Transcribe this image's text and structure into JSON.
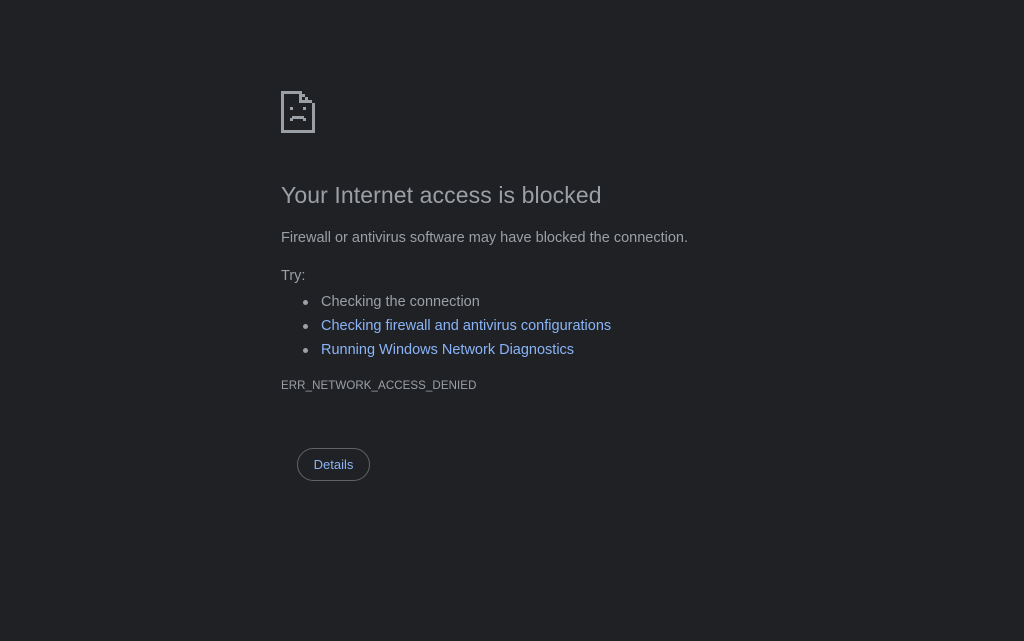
{
  "error": {
    "title": "Your Internet access is blocked",
    "description": "Firewall or antivirus software may have blocked the connection.",
    "try_label": "Try:",
    "suggestions": [
      {
        "text": "Checking the connection",
        "is_link": false
      },
      {
        "text": "Checking firewall and antivirus configurations",
        "is_link": true
      },
      {
        "text": "Running Windows Network Diagnostics",
        "is_link": true
      }
    ],
    "code": "ERR_NETWORK_ACCESS_DENIED",
    "details_label": "Details"
  },
  "icons": {
    "error_icon": "sad-document-icon"
  },
  "colors": {
    "background": "#202124",
    "text": "#9aa0a6",
    "link": "#8ab4f8",
    "button_border": "#5f6368"
  }
}
